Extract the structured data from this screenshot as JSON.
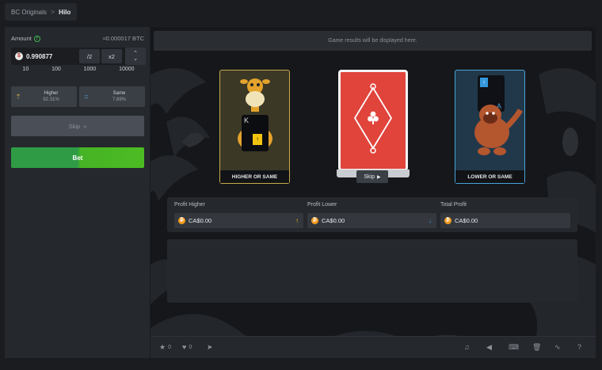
{
  "breadcrumb": {
    "parent": "BC Originals",
    "separator": ">",
    "current": "Hilo"
  },
  "bet_panel": {
    "amount_label": "Amount",
    "btc_equivalent": "≈0.000017 BTC",
    "amount_value": "0.990877",
    "coin_symbol": "$",
    "half_label": "/2",
    "double_label": "x2",
    "presets": [
      "10",
      "100",
      "1000",
      "10000"
    ],
    "higher": {
      "label": "Higher",
      "percent": "92.31%"
    },
    "same": {
      "label": "Same",
      "percent": "7.69%"
    },
    "skip_label": "Skip",
    "bet_label": "Bet"
  },
  "game": {
    "results_placeholder": "Game results will be displayed here.",
    "left_card": {
      "rank": "K",
      "caption": "HIGHER OR SAME"
    },
    "right_card": {
      "rank": "A",
      "caption": "LOWER OR SAME"
    },
    "center_skip_label": "Skip",
    "profits": [
      {
        "label": "Profit Higher",
        "value": "CA$0.00",
        "arrow": "↑",
        "arrow_color": "#f1c40f"
      },
      {
        "label": "Profit Lower",
        "value": "CA$0.00",
        "arrow": "↓",
        "arrow_color": "#3498db"
      },
      {
        "label": "Total Profit",
        "value": "CA$0.00"
      }
    ]
  },
  "bottom_bar": {
    "likes": "0",
    "hearts": "0"
  },
  "colors": {
    "bet_green": "#2f9c45",
    "bet_lime": "#4cbb23",
    "card_red": "#e0443b",
    "higher_gold": "#c8a94a",
    "lower_blue": "#4aa3d6"
  },
  "icons": [
    "info-icon",
    "coin-icon",
    "chevron-up-down-icon",
    "arrow-up-icon",
    "equals-icon",
    "double-chevron-right-icon",
    "clubs-icon",
    "star-icon",
    "heart-icon",
    "send-icon",
    "music-icon",
    "volume-icon",
    "keyboard-icon",
    "trash-icon",
    "chart-icon",
    "help-icon"
  ]
}
